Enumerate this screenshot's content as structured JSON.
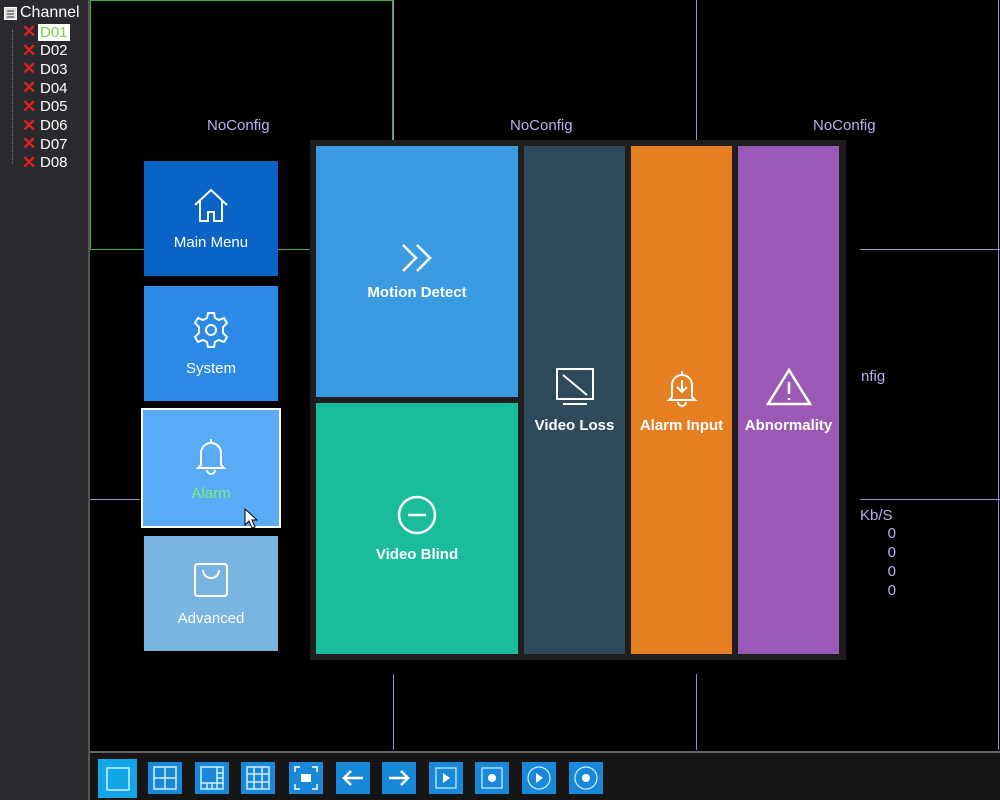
{
  "sidebar": {
    "title": "Channel",
    "channels": [
      {
        "label": "D01",
        "status": "offline",
        "selected": true
      },
      {
        "label": "D02",
        "status": "offline"
      },
      {
        "label": "D03",
        "status": "offline"
      },
      {
        "label": "D04",
        "status": "offline"
      },
      {
        "label": "D05",
        "status": "offline"
      },
      {
        "label": "D06",
        "status": "offline"
      },
      {
        "label": "D07",
        "status": "offline"
      },
      {
        "label": "D08",
        "status": "offline"
      }
    ]
  },
  "video": {
    "cells": [
      "NoConfig",
      "NoConfig",
      "NoConfig"
    ],
    "partial_label": "nfig",
    "bitrate": {
      "header": "Kb/S",
      "values": [
        "0",
        "0",
        "0",
        "0"
      ]
    }
  },
  "menu": {
    "items": [
      {
        "label": "Main Menu",
        "icon": "home-icon",
        "color": "#0a64c8"
      },
      {
        "label": "System",
        "icon": "gear-icon",
        "color": "#2a8ae6"
      },
      {
        "label": "Alarm",
        "icon": "bell-icon",
        "color": "#5aabf5",
        "selected": true
      },
      {
        "label": "Advanced",
        "icon": "bag-icon",
        "color": "#7ab4e0"
      }
    ]
  },
  "alarm_panel": {
    "tiles": [
      {
        "label": "Motion Detect",
        "icon": "double-chevron-icon",
        "color": "#3a9be0"
      },
      {
        "label": "Video Blind",
        "icon": "minus-circle-icon",
        "color": "#1abc9c"
      },
      {
        "label": "Video Loss",
        "icon": "monitor-slash-icon",
        "color": "#2f4a5a"
      },
      {
        "label": "Alarm Input",
        "icon": "bell-download-icon",
        "color": "#e67e22"
      },
      {
        "label": "Abnormality",
        "icon": "warning-icon",
        "color": "#9b59b6"
      }
    ]
  },
  "toolbar": {
    "buttons": [
      "single-view",
      "quad-view",
      "6-split-view",
      "9-split-view",
      "fullscreen",
      "previous",
      "next",
      "playback",
      "record",
      "play",
      "record-circle"
    ]
  }
}
